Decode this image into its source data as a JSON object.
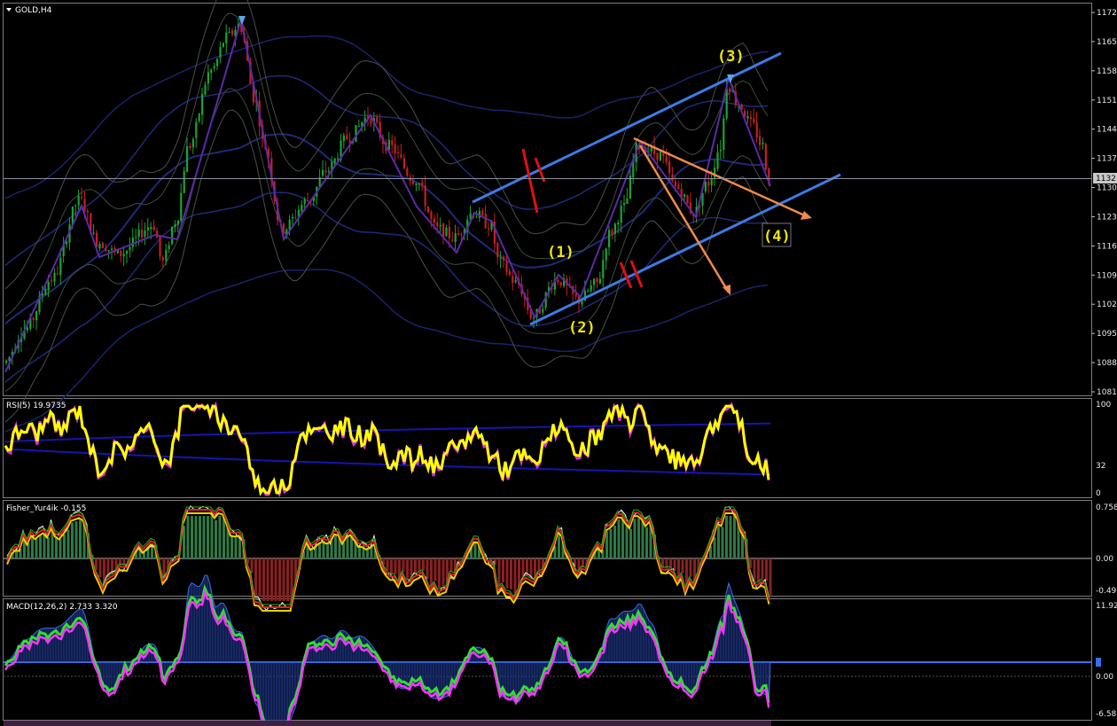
{
  "window": {
    "title": "GOLD,H4"
  },
  "colors": {
    "background": "#000000",
    "bull": "#17a532",
    "bear": "#c81e1e",
    "channel": "#3d7be6",
    "fan": "#f08a4b",
    "wave_label": "#f2e600",
    "rsi": "#ffff00",
    "macd": "#30e030",
    "signal": "#ff33ff"
  },
  "main_chart": {
    "symbol": "GOLD,H4",
    "last_price": "1132",
    "ylim": [
      1080,
      1173
    ],
    "y_ticks": [
      "1172",
      "1165",
      "1158",
      "1151",
      "1144",
      "1137",
      "1130",
      "1123",
      "1116",
      "1109",
      "1102",
      "1095",
      "1088",
      "1081"
    ],
    "wave_labels": [
      "(1)",
      "(2)",
      "(3)",
      "(4)"
    ]
  },
  "rsi_panel": {
    "label": "RSI(5) 19.9735",
    "y_ticks": [
      "100",
      "32",
      "0"
    ]
  },
  "fisher_panel": {
    "label": "Fisher_Yur4ik -0.155",
    "y_ticks": [
      "0.758",
      "0.00",
      "-0.492"
    ]
  },
  "macd_panel": {
    "label": "MACD(12,26,2) 2.733 3.320",
    "y_ticks": [
      "11.92",
      "0.00",
      "-6.58"
    ]
  },
  "chart_data": [
    {
      "type": "candlestick",
      "title": "GOLD,H4",
      "ylim": [
        1080,
        1173
      ],
      "key_points": [
        {
          "x": "start",
          "y": 1090
        },
        {
          "x": "peak",
          "y": 1170
        },
        {
          "x": "wave (2)",
          "y": 1099
        },
        {
          "x": "wave (3)",
          "y": 1156
        },
        {
          "x": "last",
          "y": 1132
        }
      ]
    },
    {
      "type": "line",
      "title": "RSI(5)",
      "ylim": [
        0,
        100
      ],
      "last": 19.9735
    },
    {
      "type": "bar",
      "title": "Fisher_Yur4ik",
      "ylim": [
        -0.492,
        0.758
      ],
      "last": -0.155
    },
    {
      "type": "line",
      "title": "MACD(12,26,2)",
      "ylim": [
        -6.58,
        11.92
      ],
      "main": 2.733,
      "signal": 3.32
    }
  ]
}
